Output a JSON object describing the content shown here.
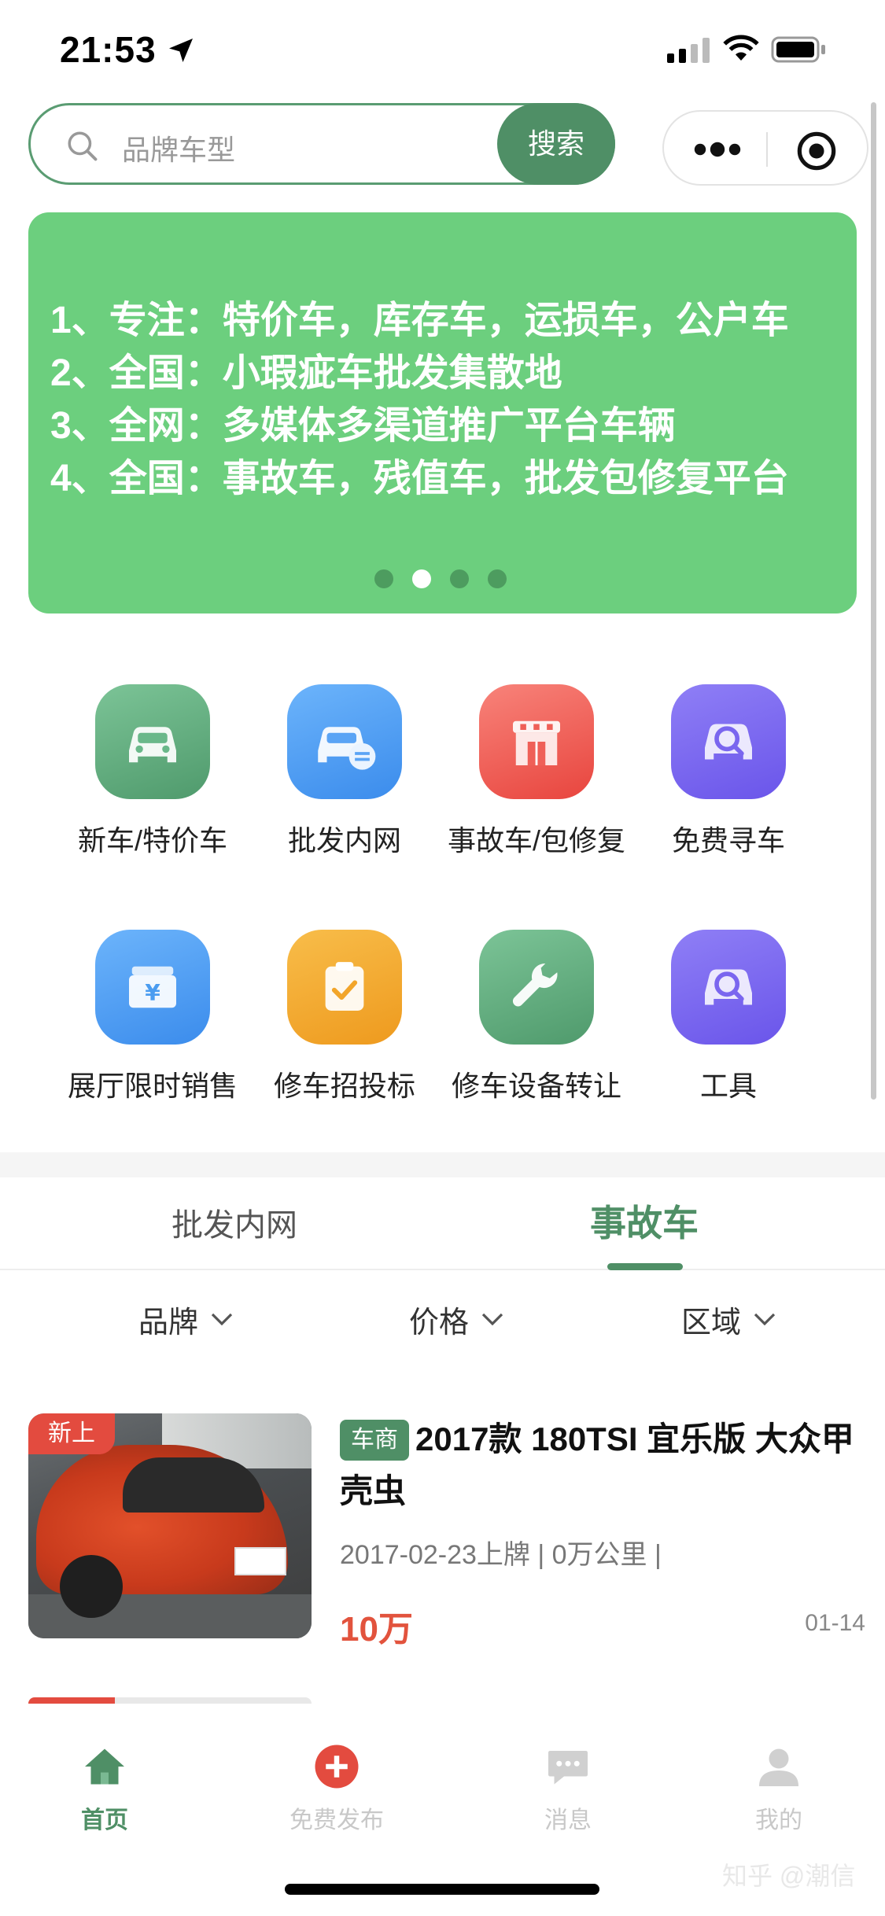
{
  "status_bar": {
    "time": "21:53"
  },
  "search": {
    "placeholder": "品牌车型",
    "button_label": "搜索"
  },
  "banner": {
    "lines": [
      "1、专注：特价车，库存车，运损车，公户车",
      "2、全国：小瑕疵车批发集散地",
      "3、全网：多媒体多渠道推广平台车辆",
      "4、全国：事故车，残值车，批发包修复平台"
    ],
    "page_count": 4,
    "active_page": 2
  },
  "grid": {
    "items": [
      {
        "label": "新车/特价车",
        "icon": "car-icon",
        "color": "#5aae7e"
      },
      {
        "label": "批发内网",
        "icon": "car-list-icon",
        "color": "#4a9cf0"
      },
      {
        "label": "事故车/包修复",
        "icon": "shop-icon",
        "color": "#ee5b53"
      },
      {
        "label": "免费寻车",
        "icon": "car-search-icon",
        "color": "#7665ef"
      },
      {
        "label": "展厅限时销售",
        "icon": "yen-box-icon",
        "color": "#4a9cf0"
      },
      {
        "label": "修车招投标",
        "icon": "clipboard-check-icon",
        "color": "#f2a52a"
      },
      {
        "label": "修车设备转让",
        "icon": "wrench-icon",
        "color": "#5aae7e"
      },
      {
        "label": "工具",
        "icon": "car-search-icon",
        "color": "#7665ef"
      }
    ]
  },
  "tabs": [
    {
      "label": "批发内网",
      "active": false
    },
    {
      "label": "事故车",
      "active": true
    }
  ],
  "filters": [
    {
      "label": "品牌"
    },
    {
      "label": "价格"
    },
    {
      "label": "区域"
    }
  ],
  "listing": {
    "badge": "新上",
    "dealer_tag": "车商",
    "title": "2017款 180TSI 宜乐版 大众甲壳虫",
    "meta": "2017-02-23上牌 | 0万公里 |",
    "price": "10万",
    "date": "01-14"
  },
  "bottom_nav": [
    {
      "label": "首页",
      "icon": "home-icon",
      "active": true
    },
    {
      "label": "免费发布",
      "icon": "plus-circle-icon",
      "active": false
    },
    {
      "label": "消息",
      "icon": "chat-icon",
      "active": false
    },
    {
      "label": "我的",
      "icon": "user-icon",
      "active": false
    }
  ],
  "watermark": "知乎 @潮信",
  "colors": {
    "primary": "#4f8f66",
    "banner": "#6ccf7e",
    "price": "#e2533d",
    "badge": "#e34b3f"
  }
}
